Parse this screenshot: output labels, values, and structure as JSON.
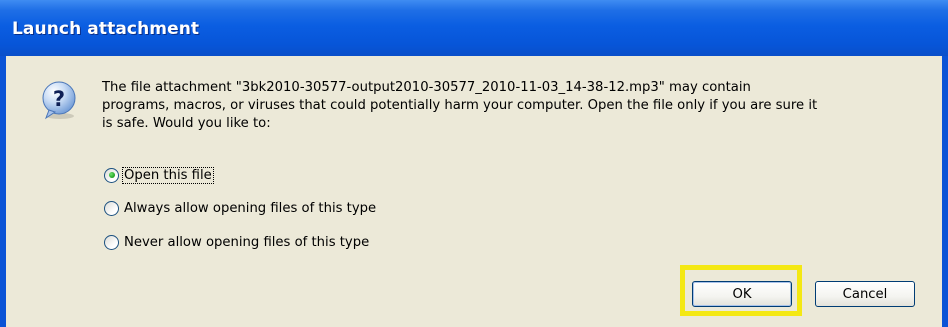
{
  "window": {
    "title": "Launch attachment"
  },
  "dialog": {
    "icon": "question-icon",
    "message_lines": [
      "The file attachment \"3bk2010-30577-output2010-30577_2010-11-03_14-38-12.mp3\" may contain",
      "programs, macros, or viruses that could potentially harm your computer. Open the file only if you are sure it",
      "is safe. Would you like to:"
    ],
    "options": [
      {
        "label": "Open this file",
        "selected": true
      },
      {
        "label": "Always allow opening files of this type",
        "selected": false
      },
      {
        "label": "Never allow opening files of this type",
        "selected": false
      }
    ]
  },
  "buttons": {
    "ok_label": "OK",
    "cancel_label": "Cancel"
  },
  "colors": {
    "titlebar": "#0755d8",
    "dialog_background": "#ece9d8",
    "highlight": "#f4e813"
  }
}
